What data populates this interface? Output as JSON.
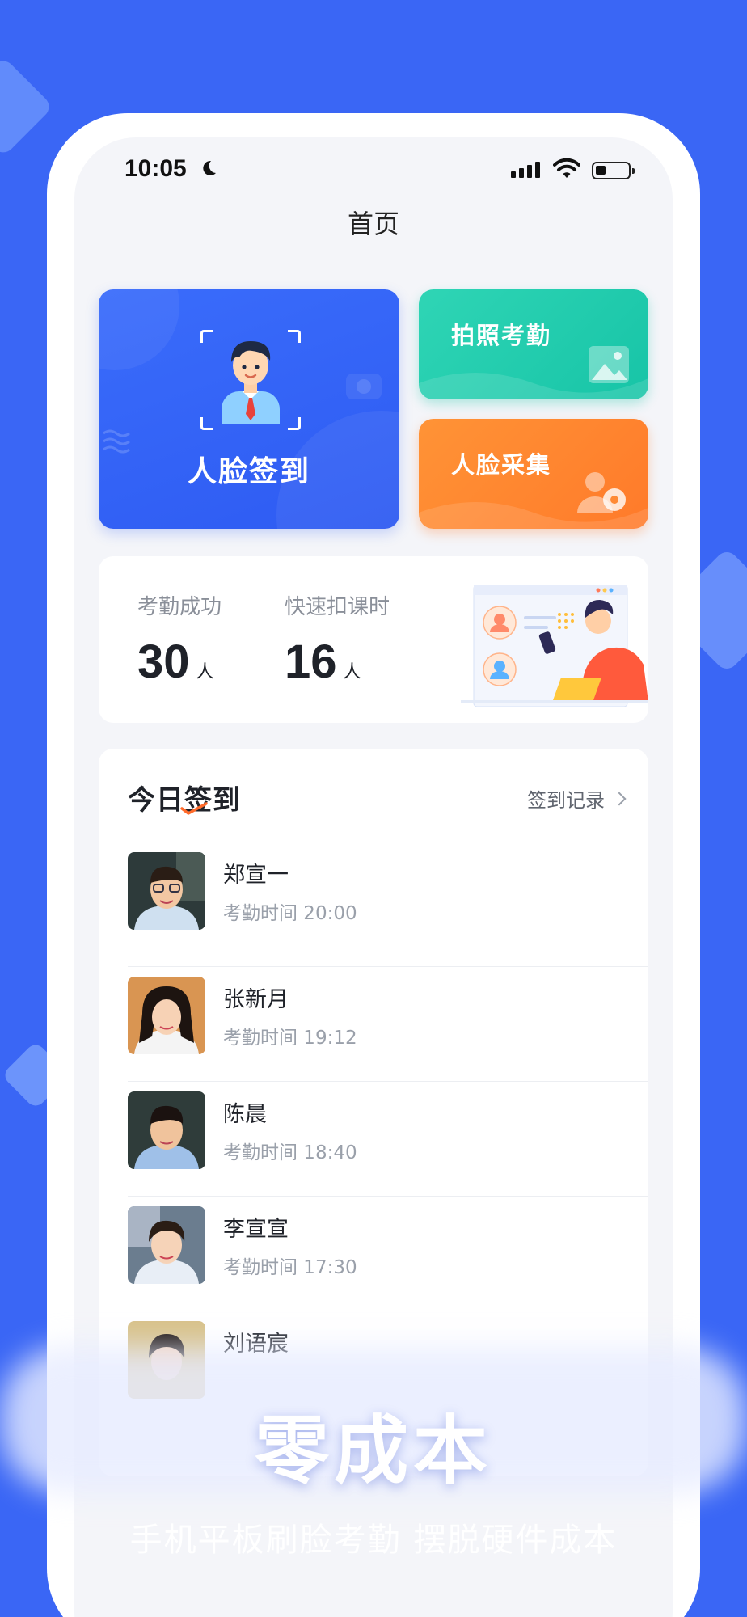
{
  "status_bar": {
    "time": "10:05"
  },
  "page_title": "首页",
  "actions": {
    "face_sign": "人脸签到",
    "photo_attendance": "拍照考勤",
    "face_collect": "人脸采集"
  },
  "stats": [
    {
      "label": "考勤成功",
      "value": "30",
      "unit": "人"
    },
    {
      "label": "快速扣课时",
      "value": "16",
      "unit": "人"
    }
  ],
  "today": {
    "title": "今日签到",
    "record_link": "签到记录",
    "rows": [
      {
        "name": "郑宣一",
        "time": "考勤时间 20:00"
      },
      {
        "name": "张新月",
        "time": "考勤时间 19:12"
      },
      {
        "name": "陈晨",
        "time": "考勤时间 18:40"
      },
      {
        "name": "李宣宣",
        "time": "考勤时间 17:30"
      },
      {
        "name": "刘语宸",
        "time": ""
      }
    ]
  },
  "promo": {
    "headline": "零成本",
    "subline": "手机平板刷脸考勤 摆脱硬件成本"
  },
  "colors": {
    "background": "#3a66f5",
    "face_card": "#2e5bf2",
    "photo_card": "#17c4a7",
    "collect_card": "#ff7a2a"
  }
}
